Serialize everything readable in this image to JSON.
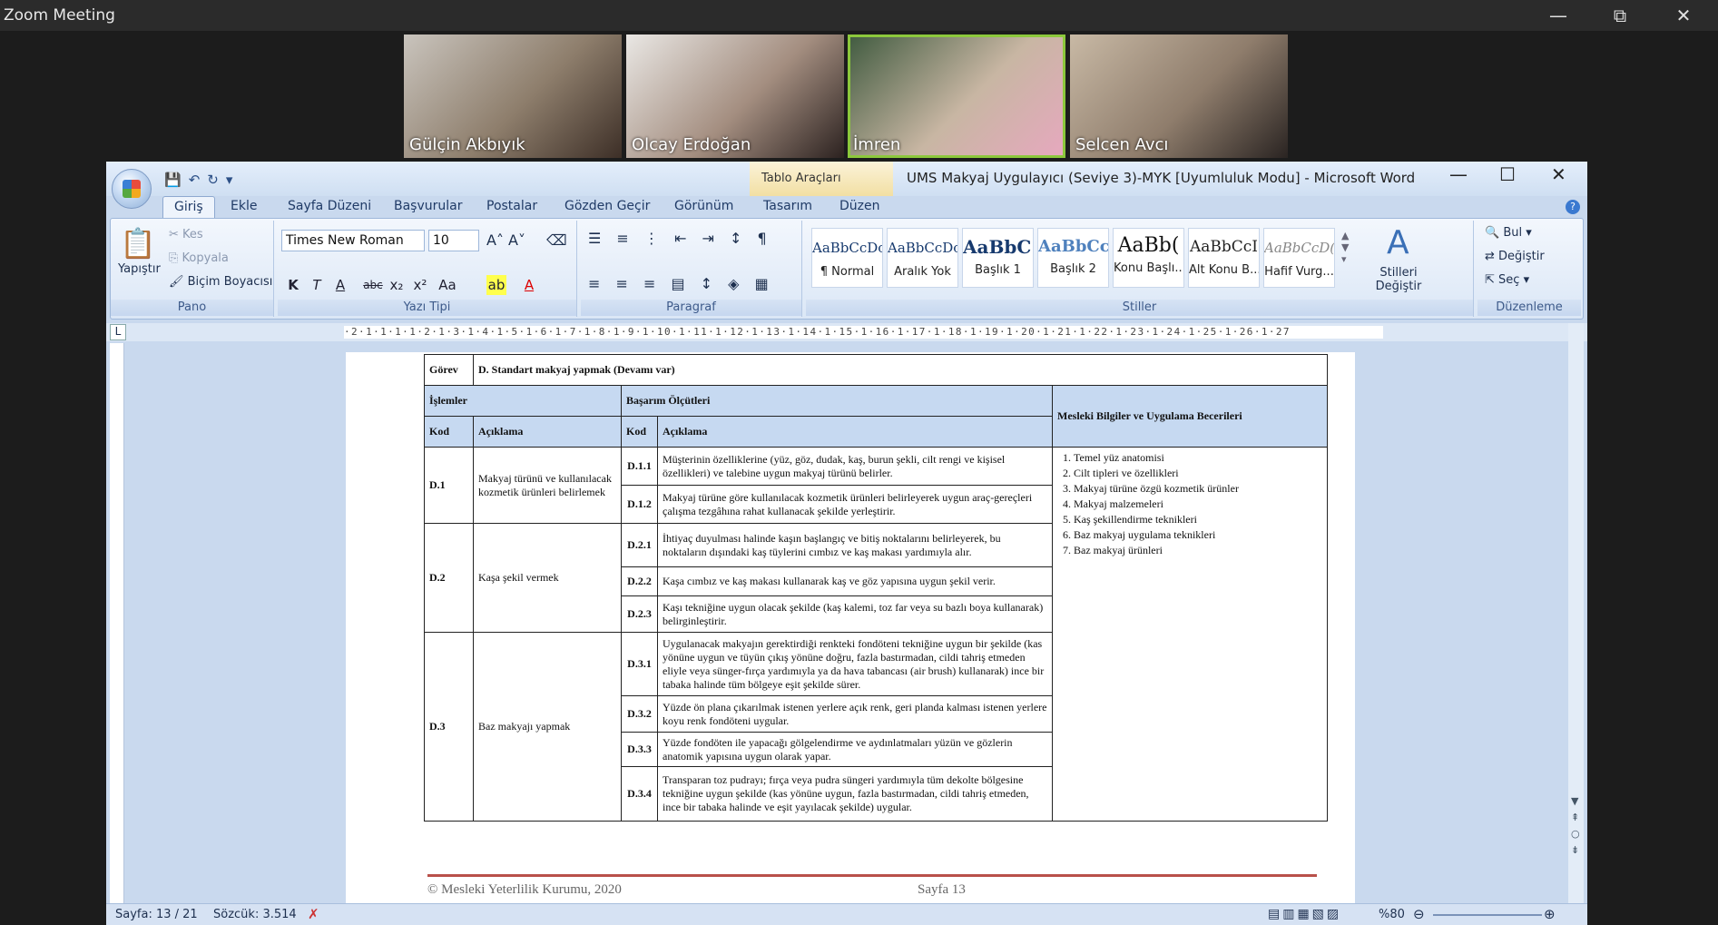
{
  "zoom": {
    "title": "Zoom Meeting",
    "controls": [
      "—",
      "⧉",
      "✕"
    ],
    "participants": [
      {
        "name": "Gülçin Akbıyık"
      },
      {
        "name": "Olcay Erdoğan"
      },
      {
        "name": "İmren",
        "active": true
      },
      {
        "name": "Selcen Avcı"
      }
    ]
  },
  "word": {
    "tool_tab": "Tablo Araçları",
    "title": "UMS Makyaj Uygulayıcı (Seviye 3)-MYK [Uyumluluk Modu] - Microsoft Word",
    "tabs": [
      "Giriş",
      "Ekle",
      "Sayfa Düzeni",
      "Başvurular",
      "Postalar",
      "Gözden Geçir",
      "Görünüm",
      "Tasarım",
      "Düzen"
    ],
    "pano": {
      "label": "Pano",
      "paste": "Yapıştır",
      "cut": "Kes",
      "copy": "Kopyala",
      "format": "Biçim Boyacısı"
    },
    "font": {
      "label": "Yazı Tipi",
      "name": "Times New Roman",
      "size": "10"
    },
    "paragraf": {
      "label": "Paragraf"
    },
    "styles": {
      "label": "Stiller",
      "items": [
        {
          "preview": "AaBbCcDc",
          "name": "¶ Normal"
        },
        {
          "preview": "AaBbCcDc",
          "name": "Aralık Yok"
        },
        {
          "preview": "AaBbC(",
          "name": "Başlık 1"
        },
        {
          "preview": "AaBbCc",
          "name": "Başlık 2"
        },
        {
          "preview": "AaBb(",
          "name": "Konu Başlı..."
        },
        {
          "preview": "AaBbCcI",
          "name": "Alt Konu B..."
        },
        {
          "preview": "AaBbCcD(",
          "name": "Hafif Vurg..."
        }
      ],
      "change": "Stilleri Değiştir"
    },
    "editing": {
      "label": "Düzenleme",
      "find": "Bul",
      "replace": "Değiştir",
      "select": "Seç"
    },
    "ruler": "·2·1·1·1·1·2·1·3·1·4·1·5·1·6·1·7·1·8·1·9·1·10·1·11·1·12·1·13·1·14·1·15·1·16·1·17·1·18·1·19·1·20·1·21·1·22·1·23·1·24·1·25·1·26·1·27",
    "status": {
      "page": "Sayfa: 13 / 21",
      "words": "Sözcük: 3.514",
      "zoom": "%80"
    }
  },
  "document": {
    "gorev_label": "Görev",
    "gorev": "D. Standart makyaj yapmak (Devamı var)",
    "h_islemler": "İşlemler",
    "h_basarim": "Başarım Ölçütleri",
    "h_mesleki": "Mesleki Bilgiler ve Uygulama Becerileri",
    "h_kod": "Kod",
    "h_aciklama": "Açıklama",
    "ops": [
      {
        "kod": "D.1",
        "aciklama": "Makyaj türünü ve kullanılacak kozmetik ürünleri belirlemek",
        "criteria": [
          {
            "kod": "D.1.1",
            "text": "Müşterinin özelliklerine (yüz, göz, dudak, kaş, burun şekli, cilt rengi ve kişisel özellikleri) ve talebine uygun makyaj türünü belirler."
          },
          {
            "kod": "D.1.2",
            "text": "Makyaj türüne göre kullanılacak kozmetik ürünleri belirleyerek uygun araç-gereçleri çalışma tezgâhına rahat kullanacak şekilde yerleştirir."
          }
        ]
      },
      {
        "kod": "D.2",
        "aciklama": "Kaşa şekil vermek",
        "criteria": [
          {
            "kod": "D.2.1",
            "text": "İhtiyaç duyulması halinde kaşın başlangıç ve bitiş noktalarını belirleyerek, bu noktaların dışındaki kaş tüylerini cımbız ve kaş makası yardımıyla alır."
          },
          {
            "kod": "D.2.2",
            "text": "Kaşa cımbız ve kaş makası kullanarak kaş ve göz yapısına uygun şekil verir."
          },
          {
            "kod": "D.2.3",
            "text": "Kaşı tekniğine uygun olacak şekilde (kaş kalemi, toz far veya su bazlı boya kullanarak) belirginleştirir."
          }
        ]
      },
      {
        "kod": "D.3",
        "aciklama": "Baz makyajı yapmak",
        "criteria": [
          {
            "kod": "D.3.1",
            "text": "Uygulanacak makyajın gerektirdiği renkteki fondöteni tekniğine uygun bir şekilde (kas yönüne uygun ve tüyün çıkış yönüne doğru, fazla bastırmadan, cildi tahriş etmeden eliyle veya sünger-fırça yardımıyla ya da hava tabancası (air brush) kullanarak) ince bir tabaka halinde tüm bölgeye eşit şekilde sürer."
          },
          {
            "kod": "D.3.2",
            "text": "Yüzde ön plana çıkarılmak istenen yerlere açık renk, geri planda kalması istenen yerlere koyu renk fondöteni uygular."
          },
          {
            "kod": "D.3.3",
            "text": "Yüzde fondöten ile yapacağı gölgelendirme ve aydınlatmaları yüzün ve gözlerin anatomik yapısına uygun olarak yapar."
          },
          {
            "kod": "D.3.4",
            "text": "Transparan toz pudrayı; fırça veya pudra süngeri yardımıyla tüm dekolte bölgesine tekniğine uygun şekilde (kas yönüne uygun, fazla bastırmadan, cildi tahriş etmeden, ince bir tabaka halinde ve eşit yayılacak şekilde) uygular."
          }
        ]
      }
    ],
    "mesleki": [
      "Temel yüz anatomisi",
      "Cilt tipleri ve özellikleri",
      "Makyaj türüne özgü kozmetik ürünler",
      "Makyaj malzemeleri",
      "Kaş şekillendirme teknikleri",
      "Baz makyaj uygulama teknikleri",
      "Baz makyaj ürünleri"
    ],
    "footer_left": "© Mesleki Yeterlilik Kurumu, 2020",
    "footer_right": "Sayfa 13"
  }
}
